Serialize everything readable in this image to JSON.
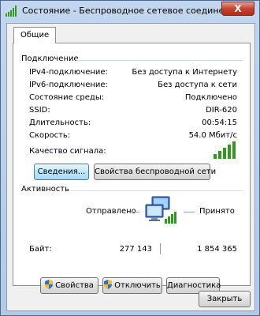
{
  "window": {
    "title": "Состояние - Беспроводное сетевое соединение",
    "close_label": "X"
  },
  "tab": {
    "label": "Общие"
  },
  "connection": {
    "heading": "Подключение",
    "rows": [
      {
        "label": "IPv4-подключение:",
        "value": "Без доступа к Интернету"
      },
      {
        "label": "IPv6-подключение:",
        "value": "Без доступа к сети"
      },
      {
        "label": "Состояние среды:",
        "value": "Подключено"
      },
      {
        "label": "SSID:",
        "value": "DIR-620"
      },
      {
        "label": "Длительность:",
        "value": "00:54:15"
      },
      {
        "label": "Скорость:",
        "value": "54.0 Мбит/с"
      }
    ],
    "signal_label": "Качество сигнала:",
    "signal_bars": 5,
    "details_button": "Сведения...",
    "wireless_props_button": "Свойства беспроводной сети"
  },
  "activity": {
    "heading": "Активность",
    "sent_label": "Отправлено",
    "received_label": "Принято",
    "bytes_label": "Байт:",
    "sent_value": "277 143",
    "received_value": "1 854 365"
  },
  "actions": {
    "properties_button": "Свойства",
    "disconnect_button": "Отключить",
    "diagnostics_button": "Диагностика"
  },
  "footer": {
    "close_button": "Закрыть"
  },
  "colors": {
    "signal_green": "#2f9a1e",
    "title_bg": "#c3d6ee",
    "accent_button": "#bee6fd"
  }
}
